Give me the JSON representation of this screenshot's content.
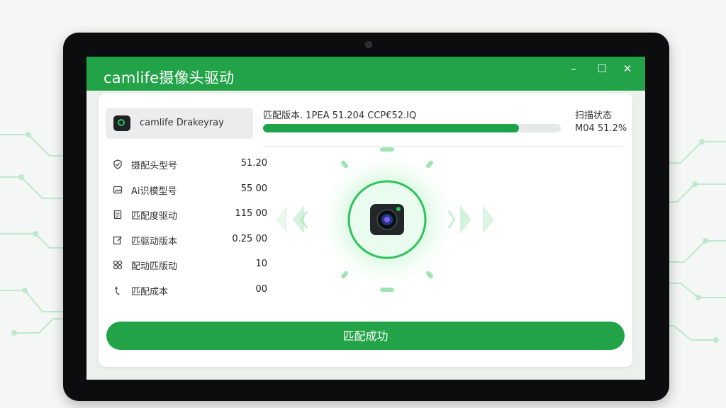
{
  "app": {
    "title": "camlife摄像头驱动",
    "window_controls": {
      "minimize": "–",
      "maximize": "☐",
      "close": "✕"
    }
  },
  "device": {
    "name": "camlife Drakeyray",
    "icon": "camera-icon"
  },
  "info_rows": [
    {
      "icon": "shield-check-icon",
      "label": "摄配头型号",
      "value": "51.20"
    },
    {
      "icon": "image-icon",
      "label": "Ai识模型号",
      "value": "55 00"
    },
    {
      "icon": "document-icon",
      "label": "匹配度驱动",
      "value": "115 00"
    },
    {
      "icon": "edit-icon",
      "label": "匹驱动版本",
      "value": "0.25 00"
    },
    {
      "icon": "link-icon",
      "label": "配动匹版动",
      "value": "10"
    },
    {
      "icon": "cursor-icon",
      "label": "匹配成本",
      "value": "00"
    }
  ],
  "version": {
    "text": "匹配版本. 1PEA 51.204 CCP€52.IQ"
  },
  "progress": {
    "value": 0.86
  },
  "status": {
    "label": "扫描状态",
    "value": "M04 51.2%"
  },
  "action": {
    "label": "匹配成功"
  },
  "colors": {
    "accent": "#22a348",
    "accent_light": "#2fc25a",
    "track": "#e7e9e8"
  }
}
